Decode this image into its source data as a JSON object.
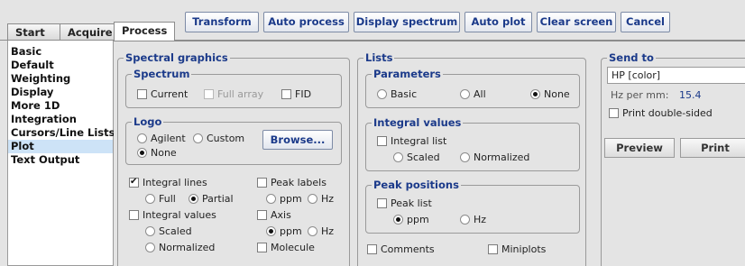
{
  "tabs": {
    "start": "Start",
    "acquire": "Acquire",
    "process": "Process"
  },
  "toolbar": {
    "transform": "Transform",
    "auto_process": "Auto process",
    "display_spectrum": "Display spectrum",
    "auto_plot": "Auto plot",
    "clear_screen": "Clear screen",
    "cancel": "Cancel"
  },
  "sidebar": {
    "items": [
      {
        "label": "Basic",
        "selected": false
      },
      {
        "label": "Default",
        "selected": false
      },
      {
        "label": "Weighting",
        "selected": false
      },
      {
        "label": "Display",
        "selected": false
      },
      {
        "label": "More 1D",
        "selected": false
      },
      {
        "label": "Integration",
        "selected": false
      },
      {
        "label": "Cursors/Line Lists",
        "selected": false
      },
      {
        "label": "Plot",
        "selected": true
      },
      {
        "label": "Text Output",
        "selected": false
      }
    ]
  },
  "spectral_graphics": {
    "title": "Spectral graphics",
    "spectrum": {
      "title": "Spectrum",
      "current": {
        "label": "Current",
        "checked": false
      },
      "full_array": {
        "label": "Full array",
        "checked": false,
        "disabled": true
      },
      "fid": {
        "label": "FID",
        "checked": false
      }
    },
    "logo": {
      "title": "Logo",
      "agilent": "Agilent",
      "custom": "Custom",
      "none": "None",
      "selected": "None",
      "browse": "Browse..."
    },
    "integral_lines": {
      "label": "Integral lines",
      "checked": true
    },
    "integral_lines_full": "Full",
    "integral_lines_partial": "Partial",
    "integral_lines_selected": "Partial",
    "peak_labels": {
      "label": "Peak labels",
      "checked": false
    },
    "peak_labels_ppm": "ppm",
    "peak_labels_hz": "Hz",
    "integral_values": {
      "label": "Integral values",
      "checked": false
    },
    "integral_values_scaled": "Scaled",
    "integral_values_normalized": "Normalized",
    "axis": {
      "label": "Axis",
      "checked": false
    },
    "axis_ppm": "ppm",
    "axis_hz": "Hz",
    "axis_selected": "ppm",
    "molecule": {
      "label": "Molecule",
      "checked": false
    }
  },
  "lists": {
    "title": "Lists",
    "parameters": {
      "title": "Parameters",
      "basic": "Basic",
      "all": "All",
      "none": "None",
      "selected": "None"
    },
    "integral_values": {
      "title": "Integral values",
      "integral_list": {
        "label": "Integral list",
        "checked": false
      },
      "scaled": "Scaled",
      "normalized": "Normalized"
    },
    "peak_positions": {
      "title": "Peak positions",
      "peak_list": {
        "label": "Peak list",
        "checked": false
      },
      "ppm": "ppm",
      "hz": "Hz",
      "selected": "ppm"
    },
    "comments": {
      "label": "Comments",
      "checked": false
    },
    "miniplots": {
      "label": "Miniplots",
      "checked": false
    }
  },
  "send_to": {
    "title": "Send to",
    "printer": "HP [color]",
    "hz_per_mm_label": "Hz per mm:",
    "hz_per_mm_value": "15.4",
    "print_double_sided": {
      "label": "Print double-sided",
      "checked": false
    },
    "preview": "Preview",
    "print": "Print"
  },
  "colors": {
    "accent": "#1b3a8a",
    "selected_nav": "#cde3f7",
    "background": "#e4e4e4"
  }
}
